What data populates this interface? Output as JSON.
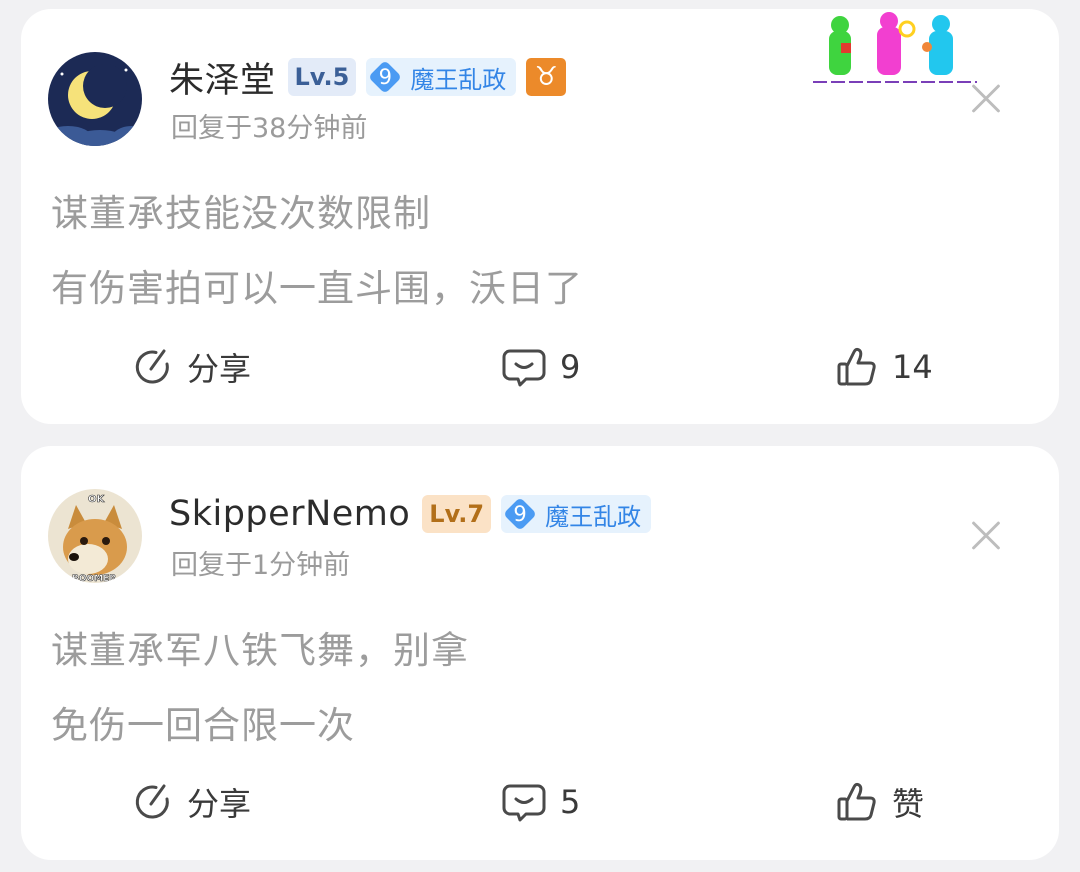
{
  "comments": [
    {
      "username": "朱泽堂",
      "level": "Lv.5",
      "tag_number": "9",
      "tag_text": "魔王乱政",
      "zodiac": "♉",
      "time": "回复于38分钟前",
      "content_lines": [
        "谋董承技能没次数限制",
        "有伤害拍可以一直斗围，沃日了"
      ],
      "share_label": "分享",
      "comment_count": "9",
      "like_label": "14"
    },
    {
      "username": "SkipperNemo",
      "level": "Lv.7",
      "tag_number": "9",
      "tag_text": "魔王乱政",
      "time": "回复于1分钟前",
      "content_lines": [
        "谋董承军八铁飞舞，别拿",
        "免伤一回合限一次"
      ],
      "share_label": "分享",
      "comment_count": "5",
      "like_label": "赞",
      "avatar_text_top": "OK",
      "avatar_text_bottom": "BOOMER"
    }
  ]
}
